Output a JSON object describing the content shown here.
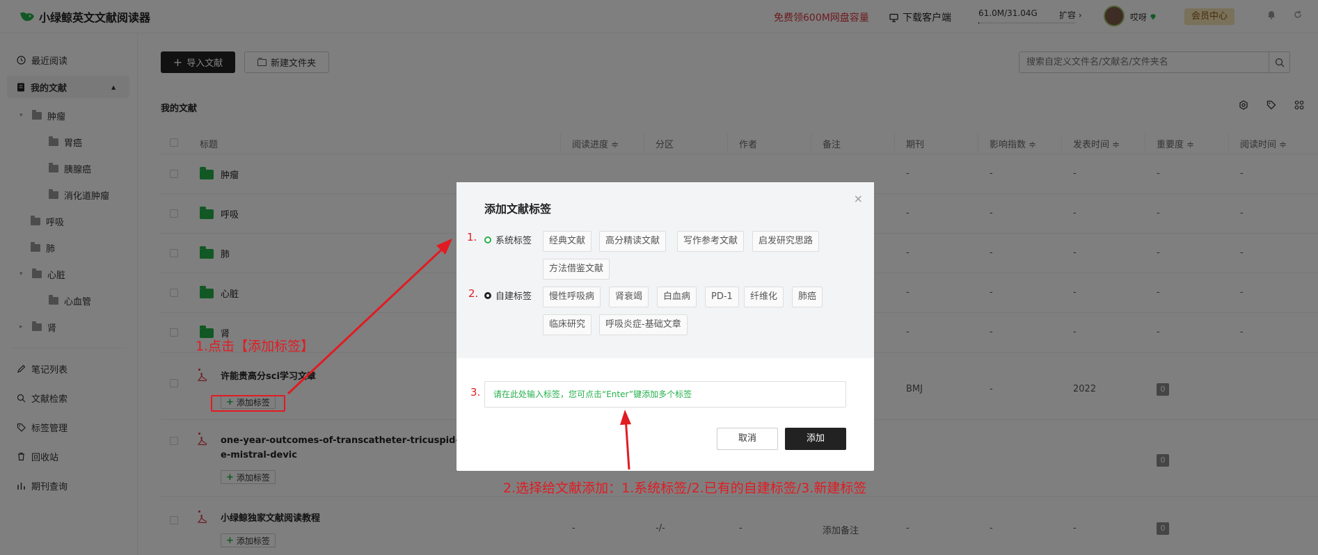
{
  "header": {
    "app_name": "小绿鲸英文文献阅读器",
    "promo": "免费领600M网盘容量",
    "download": "下载客户端",
    "storage_text": "61.0M/31.04G",
    "storage_used_fraction": 0.002,
    "expand": "扩容 ›",
    "username": "哎呀",
    "vip": "会员中心"
  },
  "sidebar": {
    "recent": "最近阅读",
    "my_docs": "我的文献",
    "folders": [
      {
        "label": "肿瘤",
        "children": [
          "胃癌",
          "胰腺癌",
          "消化道肿瘤"
        ]
      },
      {
        "label": "呼吸",
        "children": []
      },
      {
        "label": "肺",
        "children": []
      },
      {
        "label": "心脏",
        "children": [
          "心血管"
        ]
      },
      {
        "label": "肾",
        "children": []
      }
    ],
    "notes": "笔记列表",
    "search": "文献检索",
    "tags": "标签管理",
    "trash": "回收站",
    "journal": "期刊查询"
  },
  "toolbar": {
    "import": "导入文献",
    "new_folder": "新建文件夹",
    "search_placeholder": "搜索自定义文件名/文献名/文件夹名"
  },
  "section_title": "我的文献",
  "table": {
    "columns": [
      "标题",
      "阅读进度 ≑",
      "分区",
      "作者",
      "备注",
      "期刊",
      "影响指数 ≑",
      "发表时间 ≑",
      "重要度 ≑",
      "阅读时间 ≑"
    ],
    "folder_rows": [
      "肿瘤",
      "呼吸",
      "肺",
      "心脏",
      "肾"
    ],
    "dash": "-",
    "docs": [
      {
        "title": "许能贵高分sci学习文章",
        "journal": "BMJ",
        "impact": "-",
        "year": "2022",
        "importance": "0",
        "add_tag": "添加标签"
      },
      {
        "title_line1": "one-year-outcomes-of-transcatheter-tricuspid-valve-r",
        "title_line2": "e-mistral-devic",
        "importance": "0",
        "add_tag": "添加标签"
      },
      {
        "title": "小绿鲸独家文献阅读教程",
        "progress": "-/-",
        "remark": "添加备注",
        "importance": "0",
        "add_tag": "添加标签"
      }
    ]
  },
  "modal": {
    "title": "添加文献标签",
    "close": "×",
    "system_label": "系统标签",
    "system_tags": [
      "经典文献",
      "高分精读文献",
      "写作参考文献",
      "启发研究思路",
      "方法借鉴文献"
    ],
    "custom_label": "自建标签",
    "custom_tags": [
      "慢性呼吸病",
      "肾衰竭",
      "白血病",
      "PD-1",
      "纤维化",
      "肺癌",
      "临床研究",
      "呼吸炎症-基础文章"
    ],
    "input_placeholder": "请在此处输入标签，您可点击“Enter”键添加多个标签",
    "cancel": "取消",
    "add": "添加"
  },
  "annotations": {
    "n1": "1.",
    "n2": "2.",
    "n3": "3.",
    "click_hint": "1.点击【添加标签】",
    "choose_hint": "2.选择给文献添加：1.系统标签/2.已有的自建标签/3.新建标签"
  },
  "colors": {
    "accent_green": "#25b04b",
    "annotation_red": "#e11b22",
    "promo_red": "#d9363e"
  }
}
